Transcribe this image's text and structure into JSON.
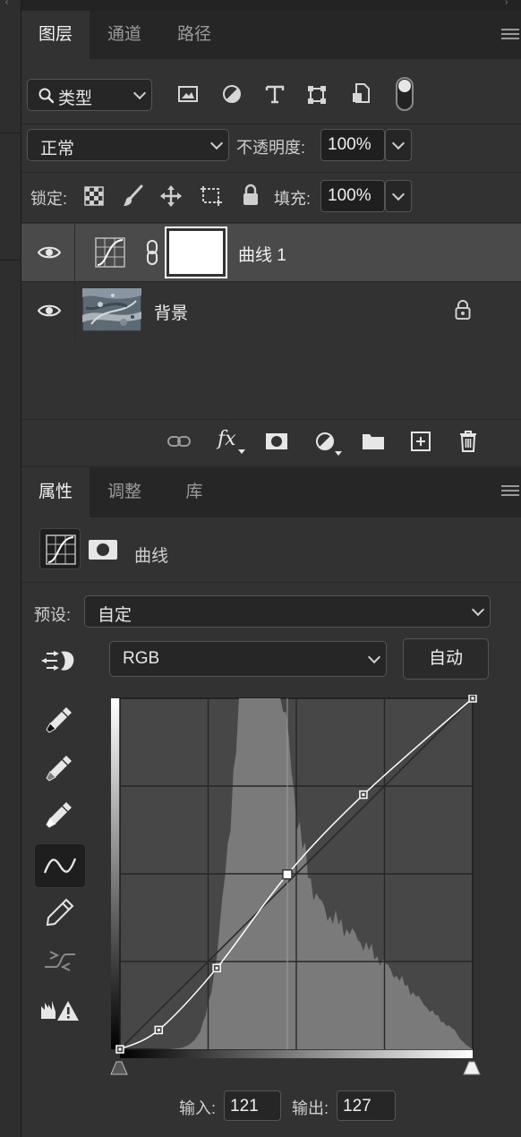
{
  "layers_panel": {
    "tabs": [
      {
        "label": "图层",
        "active": true
      },
      {
        "label": "通道",
        "active": false
      },
      {
        "label": "路径",
        "active": false
      }
    ],
    "filter_dropdown": {
      "value": "类型"
    },
    "filter_icons": [
      "image-filter-icon",
      "adjustment-filter-icon",
      "type-filter-icon",
      "shape-filter-icon",
      "smart-object-filter-icon",
      "filter-toggle-switch"
    ],
    "blend_mode": {
      "value": "正常"
    },
    "opacity": {
      "label": "不透明度:",
      "value": "100%"
    },
    "lock": {
      "label": "锁定:"
    },
    "fill": {
      "label": "填充:",
      "value": "100%"
    },
    "layers": [
      {
        "name": "曲线 1",
        "type": "adjustment-curves",
        "selected": true,
        "visible": true
      },
      {
        "name": "背景",
        "type": "image",
        "selected": false,
        "visible": true,
        "locked": true
      }
    ],
    "footer_icons": [
      "link-layers-icon",
      "fx-icon",
      "add-mask-icon",
      "new-adjustment-icon",
      "group-folder-icon",
      "new-layer-icon",
      "trash-icon"
    ],
    "fx_label": "fx"
  },
  "properties_panel": {
    "tabs": [
      {
        "label": "属性",
        "active": true
      },
      {
        "label": "调整",
        "active": false
      },
      {
        "label": "库",
        "active": false
      }
    ],
    "title": "曲线",
    "preset": {
      "label": "预设:",
      "value": "自定"
    },
    "channel": {
      "value": "RGB"
    },
    "auto_button": "自动",
    "tools": [
      "eyedropper-black-icon",
      "eyedropper-gray-icon",
      "eyedropper-white-icon",
      "curve-point-tool-icon",
      "pencil-icon",
      "smooth-curve-icon",
      "clipping-warning-icon"
    ],
    "input": {
      "label": "输入:",
      "value": "121"
    },
    "output": {
      "label": "输出:",
      "value": "127"
    },
    "curve_points": [
      [
        0,
        0
      ],
      [
        28,
        14
      ],
      [
        70,
        59
      ],
      [
        121,
        127
      ],
      [
        176,
        185
      ],
      [
        255,
        255
      ]
    ],
    "selected_point": [
      121,
      127
    ],
    "colors": {
      "panel": "#323232",
      "graph_bg": "#474747",
      "histogram": "#7a7a7a"
    }
  }
}
